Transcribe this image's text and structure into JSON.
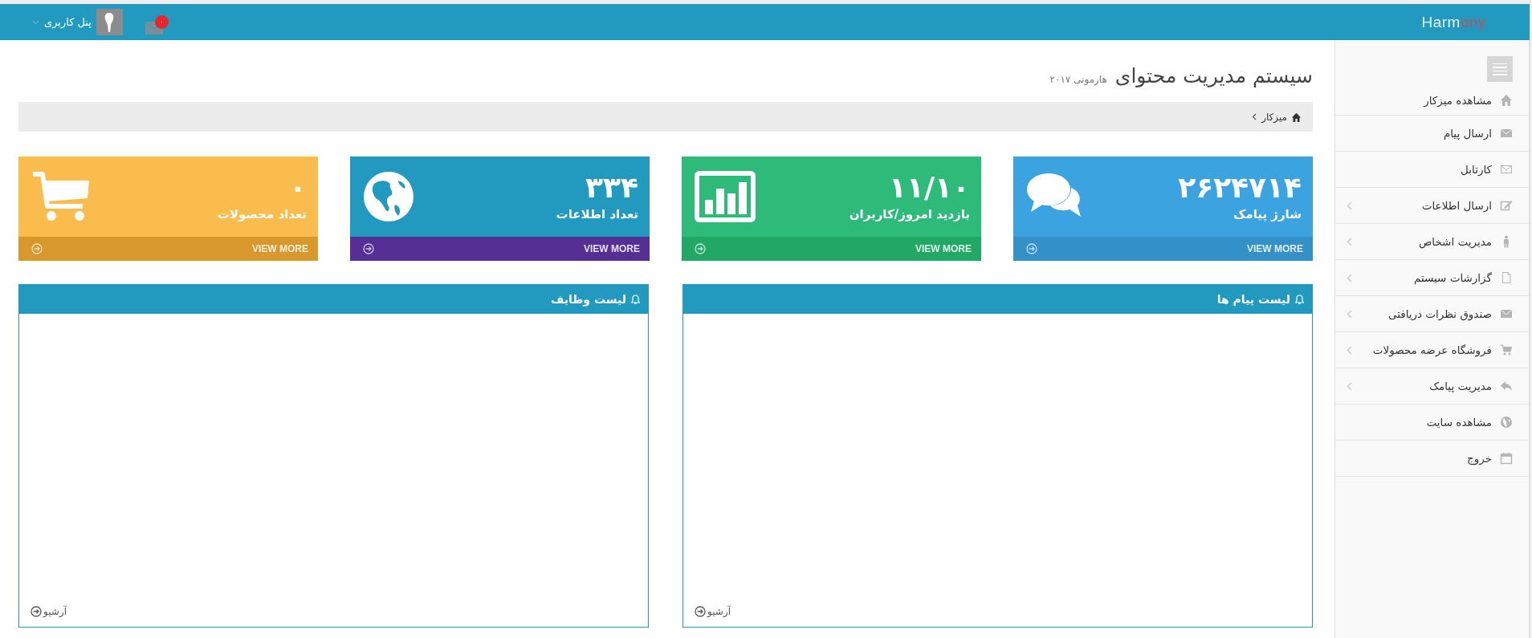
{
  "topbar": {
    "logo": {
      "main": "Harm",
      "accent": "ony"
    },
    "user_menu": {
      "label": "پنل کاربری"
    },
    "messages_badge": "۰"
  },
  "header": {
    "title": "سیستم مدیریت محتوای",
    "subtitle": "هارمونی ۲۰۱۷"
  },
  "breadcrumb": [
    {
      "label": "میزکار"
    }
  ],
  "sidebar": {
    "items": [
      {
        "label": "مشاهده میزکار",
        "has_submenu": false
      },
      {
        "label": "ارسال پیام",
        "has_submenu": false
      },
      {
        "label": "کارتابل",
        "has_submenu": false
      },
      {
        "label": "ارسال اطلاعات",
        "has_submenu": true
      },
      {
        "label": "مدیریت اشخاص",
        "has_submenu": true
      },
      {
        "label": "گزارشات سیستم",
        "has_submenu": true
      },
      {
        "label": "صندوق نظرات دریافتی",
        "has_submenu": true
      },
      {
        "label": "فروشگاه عرضه محصولات",
        "has_submenu": true
      },
      {
        "label": "مدیریت پیامک",
        "has_submenu": true
      },
      {
        "label": "مشاهده سایت",
        "has_submenu": false
      },
      {
        "label": "خروج",
        "has_submenu": false
      }
    ]
  },
  "cards": [
    {
      "value": "۲۶۲۴۷۱۴",
      "label": "شارژ پیامک",
      "color": "#3aa3e0",
      "footer": {
        "link": "VIEW MORE",
        "color": "#3391c8"
      }
    },
    {
      "value": "۱۱/۱۰",
      "label": "بازدید امروز/کاربران",
      "color": "#2eba78",
      "footer": {
        "link": "VIEW MORE",
        "color": "#22a865"
      }
    },
    {
      "value": "۳۳۴",
      "label": "تعداد اطلاعات",
      "color": "#229ac0",
      "footer": {
        "link": "VIEW MORE",
        "color": "#552f94"
      }
    },
    {
      "value": "۰",
      "label": "تعداد محصولات",
      "color": "#fbbc4e",
      "footer": {
        "link": "VIEW MORE",
        "color": "#d9982b"
      }
    }
  ],
  "panels": [
    {
      "title": "لیست پیام ها",
      "footer_link": "آرشیو"
    },
    {
      "title": "لیست وظایف",
      "footer_link": "آرشیو"
    }
  ]
}
